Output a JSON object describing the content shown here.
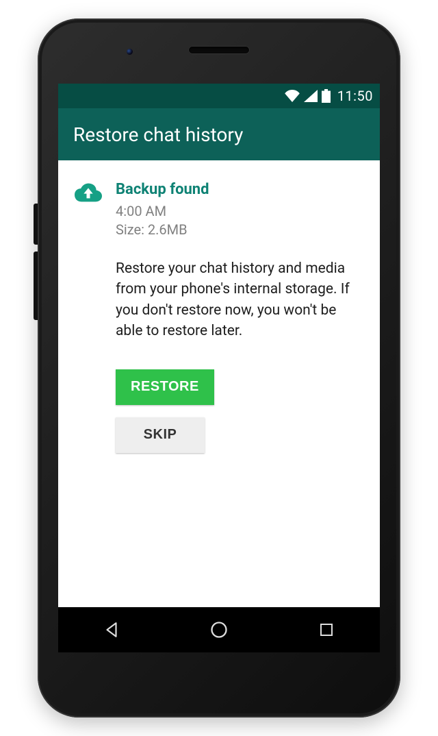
{
  "statusbar": {
    "time": "11:50"
  },
  "appbar": {
    "title": "Restore chat history"
  },
  "backup": {
    "heading": "Backup found",
    "time": "4:00 AM",
    "size_label": "Size: 2.6MB",
    "description": "Restore your chat history and media from your phone's internal storage. If you don't restore now, you won't be able to restore later."
  },
  "buttons": {
    "restore": "RESTORE",
    "skip": "SKIP"
  },
  "colors": {
    "status_bar": "#064D44",
    "app_bar": "#0D6158",
    "accent_text": "#0E8274",
    "primary_button": "#2FC14A"
  }
}
